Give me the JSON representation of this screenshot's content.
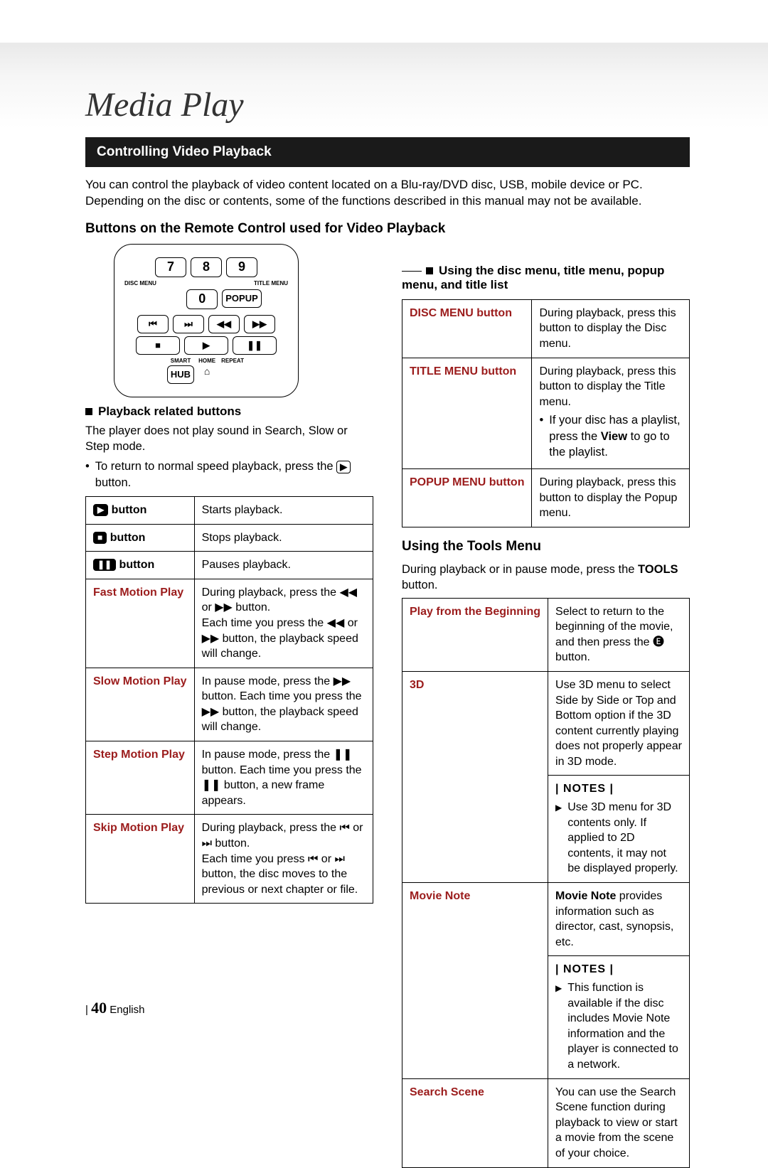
{
  "chapterTitle": "Media Play",
  "sectionBar": "Controlling Video Playback",
  "introText": "You can control the playback of video content located on a Blu-ray/DVD disc, USB, mobile device or PC. Depending on the disc or contents, some of the functions described in this manual may not be available.",
  "subhead": "Buttons on the Remote Control used for Video Playback",
  "remote": {
    "discMenu": "DISC MENU",
    "titleMenu": "TITLE MENU",
    "popup": "POPUP",
    "smart": "SMART",
    "hub": "HUB",
    "home": "HOME",
    "repeat": "REPEAT",
    "n7": "7",
    "n8": "8",
    "n9": "9",
    "n0": "0",
    "prev": "⏮",
    "next": "⏭",
    "rew": "◀◀",
    "ff": "▶▶",
    "stop": "■",
    "play": "▶",
    "pause": "❚❚",
    "homeIcon": "⌂"
  },
  "left": {
    "playbackHeader": "Playback related buttons",
    "playbackBody": "The player does not play sound in Search, Slow or Step mode.",
    "returnBullet1": "To return to normal speed playback, press the ",
    "returnBullet2": " button.",
    "table": [
      {
        "label": " button",
        "glyph": "▶",
        "desc": "Starts playback."
      },
      {
        "label": " button",
        "glyph": "■",
        "desc": "Stops playback."
      },
      {
        "label": " button",
        "glyph": "❚❚",
        "desc": "Pauses playback."
      },
      {
        "label": "Fast Motion Play",
        "desc": "During playback, press the ◀◀ or ▶▶ button.\nEach time you press the ◀◀ or ▶▶ button, the playback speed will change."
      },
      {
        "label": "Slow Motion Play",
        "desc": "In pause mode, press the ▶▶ button. Each time you press the ▶▶ button, the playback speed will change."
      },
      {
        "label": "Step Motion Play",
        "desc": "In pause mode, press the ❚❚ button. Each time you press the ❚❚ button, a new frame appears."
      },
      {
        "label": "Skip Motion Play",
        "desc": "During playback, press the ⏮ or ⏭ button.\nEach time you press ⏮ or ⏭ button, the disc moves to the previous or next chapter or file."
      }
    ]
  },
  "right": {
    "menuHeader": "Using the disc menu, title menu, popup menu, and title list",
    "menuTable": [
      {
        "label": "DISC MENU button",
        "desc": "During playback, press this button to display the Disc menu."
      },
      {
        "label": "TITLE MENU button",
        "desc": "During playback, press this button to display the Title menu.",
        "sub": "If your disc has a playlist, press the View to go to the playlist.",
        "boldWord": "View"
      },
      {
        "label": "POPUP MENU button",
        "desc": "During playback, press this button to display the Popup menu."
      }
    ],
    "toolsHeader": "Using the Tools Menu",
    "toolsIntro1": "During playback or in pause mode, press the ",
    "toolsIntroBold": "TOOLS",
    "toolsIntro2": " button.",
    "toolsTable": {
      "playFrom": {
        "label": "Play from the Beginning",
        "desc": "Select to return to the beginning of the movie, and then press the 🅔 button."
      },
      "threeD": {
        "label": "3D",
        "desc": "Use 3D menu to select Side by Side or Top and Bottom option if the 3D content currently playing does not properly appear in 3D mode.",
        "notes": "| NOTES |",
        "note1": "Use 3D menu for 3D contents only. If applied to 2D contents, it may not be displayed properly."
      },
      "movieNote": {
        "label": "Movie Note",
        "lead": "Movie Note",
        "leadRest": " provides information such as director, cast, synopsis, etc.",
        "notes": "| NOTES |",
        "note1": "This function is available if the disc includes Movie Note information and the player is connected to a network."
      },
      "searchScene": {
        "label": "Search Scene",
        "desc": "You can use the Search Scene function during playback to view or start a movie from the scene of your choice."
      }
    }
  },
  "footer": {
    "pageNum": "40",
    "lang": "English",
    "divider": "| "
  }
}
